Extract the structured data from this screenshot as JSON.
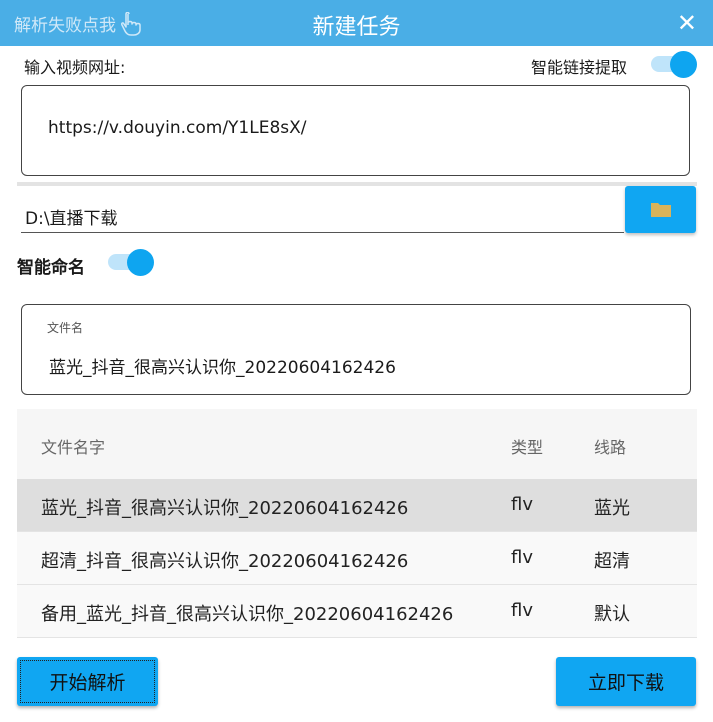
{
  "window": {
    "title": "新建任务",
    "help_link": "解析失败点我",
    "close_glyph": "✕"
  },
  "url": {
    "label": "输入视频网址:",
    "value": "https://v.douyin.com/Y1LE8sX/",
    "smart_link_label": "智能链接提取",
    "smart_link_on": true
  },
  "path": {
    "value": "D:\\直播下载"
  },
  "naming": {
    "label": "智能命名",
    "on": true
  },
  "filename": {
    "caption": "文件名",
    "value": "蓝光_抖音_很高兴认识你_20220604162426"
  },
  "table": {
    "headers": [
      "文件名字",
      "类型",
      "线路"
    ],
    "rows": [
      {
        "name": "蓝光_抖音_很高兴认识你_20220604162426",
        "type": "flv",
        "line": "蓝光",
        "selected": true
      },
      {
        "name": "超清_抖音_很高兴认识你_20220604162426",
        "type": "flv",
        "line": "超清",
        "selected": false
      },
      {
        "name": "备用_蓝光_抖音_很高兴认识你_20220604162426",
        "type": "flv",
        "line": "默认",
        "selected": false
      }
    ]
  },
  "buttons": {
    "parse": "开始解析",
    "download": "立即下载"
  },
  "colors": {
    "titlebar": "#4aaee6",
    "accent": "#10a6f2",
    "folder_icon": "#d9b35a"
  },
  "icons": {
    "help": "pointing-hand-icon",
    "folder": "folder-icon",
    "close": "close-icon"
  }
}
